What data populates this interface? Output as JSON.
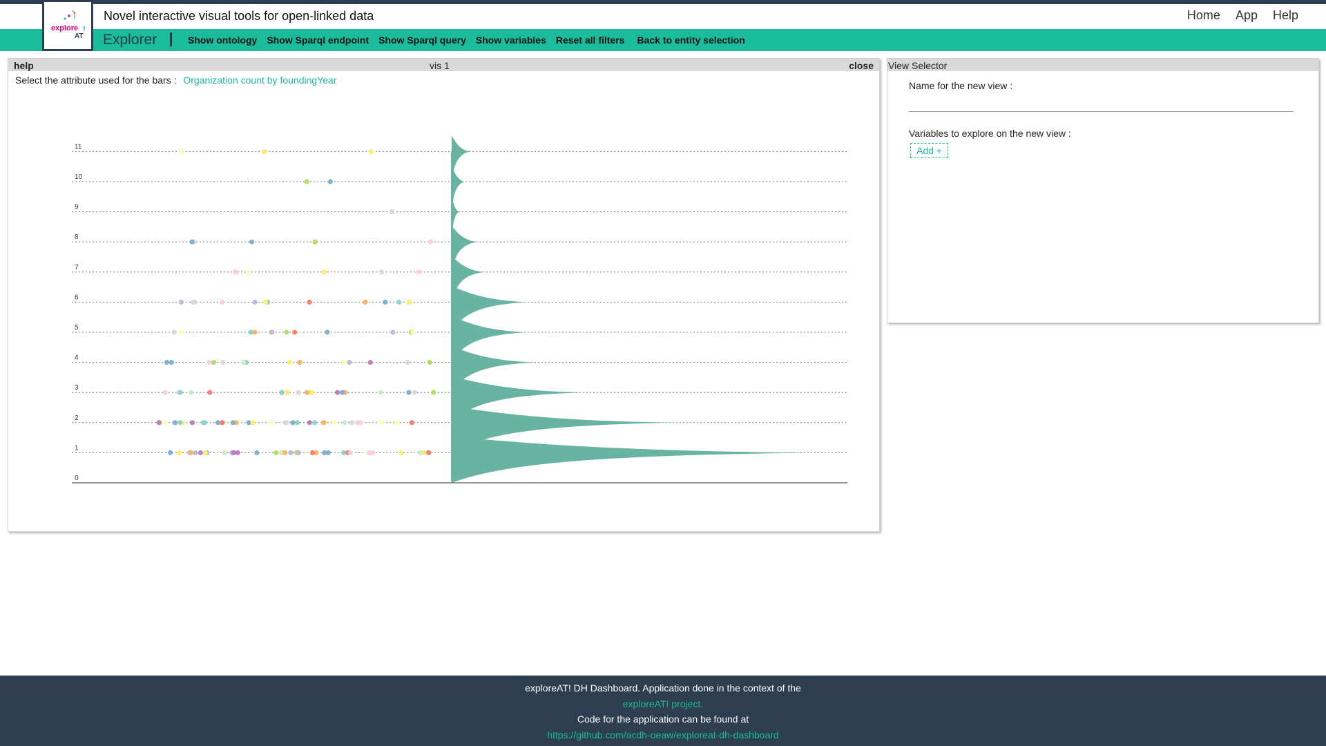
{
  "header": {
    "title": "Novel interactive visual tools for open-linked data",
    "logo_text": "exploreAT!",
    "nav": [
      "Home",
      "App",
      "Help"
    ]
  },
  "subbar": {
    "app_name": "Explorer",
    "menu": [
      "Show ontology",
      "Show Sparql endpoint",
      "Show Sparql query",
      "Show variables",
      "Reset all filters",
      "Back to entity selection"
    ]
  },
  "vis_panel": {
    "help_label": "help",
    "title": "vis 1",
    "close_label": "close",
    "attribute_prompt": "Select the attribute used for the bars :",
    "attribute_value": "Organization count by foundingYear"
  },
  "chart_data": {
    "type": "violin",
    "y_ticks": [
      0,
      1,
      2,
      3,
      4,
      5,
      6,
      7,
      8,
      9,
      10,
      11
    ],
    "ylim": [
      0,
      11
    ],
    "grid": "dotted horizontal",
    "series_color": "#69b3a2",
    "density": [
      {
        "y": 1,
        "width": 1.0
      },
      {
        "y": 2,
        "width": 0.62
      },
      {
        "y": 3,
        "width": 0.36
      },
      {
        "y": 4,
        "width": 0.23
      },
      {
        "y": 5,
        "width": 0.21
      },
      {
        "y": 6,
        "width": 0.21
      },
      {
        "y": 7,
        "width": 0.09
      },
      {
        "y": 8,
        "width": 0.07
      },
      {
        "y": 9,
        "width": 0.02
      },
      {
        "y": 10,
        "width": 0.035
      },
      {
        "y": 11,
        "width": 0.05
      }
    ],
    "point_rows": [
      {
        "y": 1,
        "count": 40
      },
      {
        "y": 2,
        "count": 34
      },
      {
        "y": 3,
        "count": 19
      },
      {
        "y": 4,
        "count": 14
      },
      {
        "y": 5,
        "count": 12
      },
      {
        "y": 6,
        "count": 12
      },
      {
        "y": 7,
        "count": 6
      },
      {
        "y": 8,
        "count": 5
      },
      {
        "y": 9,
        "count": 1
      },
      {
        "y": 10,
        "count": 2
      },
      {
        "y": 11,
        "count": 3
      }
    ],
    "point_colors": [
      "#8dd3c7",
      "#ffffb3",
      "#bebada",
      "#fb8072",
      "#80b1d3",
      "#fdb462",
      "#b3de69",
      "#fccde5",
      "#d9d9d9",
      "#bc80bd",
      "#ccebc5",
      "#ffed6f"
    ]
  },
  "view_selector": {
    "title": "View Selector",
    "name_label": "Name for the new view :",
    "name_value": "",
    "variables_label": "Variables to explore on the new view :",
    "add_label": "Add +"
  },
  "footer": {
    "line1": "exploreAT! DH Dashboard. Application done in the context of the",
    "link1": "exploreAT! project.",
    "line2": "Code for the application can be found at",
    "link2": "https://github.com/acdh-oeaw/exploreat-dh-dashboard"
  }
}
